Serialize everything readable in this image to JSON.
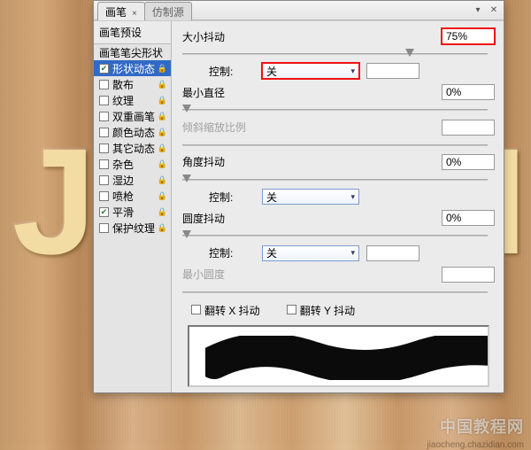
{
  "titlebar": {
    "tab_active": "画笔",
    "tab_inactive": "仿制源",
    "tab_close": "×",
    "collapse": "▾",
    "close": "✕"
  },
  "sidebar": {
    "preset": "画笔预设",
    "items": [
      {
        "label": "画笔笔尖形状",
        "checked": null,
        "active": false
      },
      {
        "label": "形状动态",
        "checked": true,
        "active": true
      },
      {
        "label": "散布",
        "checked": false,
        "active": false
      },
      {
        "label": "纹理",
        "checked": false,
        "active": false
      },
      {
        "label": "双重画笔",
        "checked": false,
        "active": false
      },
      {
        "label": "颜色动态",
        "checked": false,
        "active": false
      },
      {
        "label": "其它动态",
        "checked": false,
        "active": false
      },
      {
        "label": "杂色",
        "checked": false,
        "active": false
      },
      {
        "label": "湿边",
        "checked": false,
        "active": false
      },
      {
        "label": "喷枪",
        "checked": false,
        "active": false
      },
      {
        "label": "平滑",
        "checked": true,
        "active": false
      },
      {
        "label": "保护纹理",
        "checked": false,
        "active": false
      }
    ]
  },
  "main": {
    "size_jitter_label": "大小抖动",
    "size_jitter_value": "75%",
    "control_off": "关",
    "control_label": "控制:",
    "min_diam_label": "最小直径",
    "min_diam_value": "0%",
    "tilt_scale_label": "倾斜缩放比例",
    "angle_jitter_label": "角度抖动",
    "angle_jitter_value": "0%",
    "round_jitter_label": "圆度抖动",
    "round_jitter_value": "0%",
    "min_round_label": "最小圆度",
    "flipx": "翻转 X 抖动",
    "flipy": "翻转 Y 抖动"
  },
  "watermark": {
    "main": "中国教程网",
    "sub": "jiaocheng.chazidian.com"
  }
}
